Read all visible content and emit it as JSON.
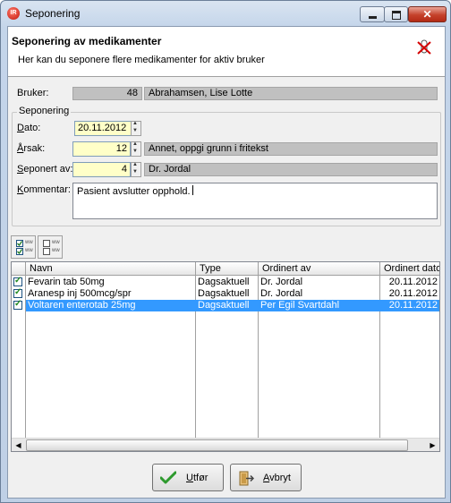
{
  "window": {
    "title": "Seponering"
  },
  "header": {
    "title": "Seponering av medikamenter",
    "subtitle": "Her kan du seponere flere medikamenter for aktiv bruker"
  },
  "bruker": {
    "label": "Bruker:",
    "id": "48",
    "name": "Abrahamsen, Lise Lotte"
  },
  "group": {
    "legend": "Seponering",
    "dato": {
      "label": "Dato:",
      "accel": "D",
      "rest": "ato:",
      "value": "20.11.2012"
    },
    "arsak": {
      "label": "Årsak:",
      "accel": "Å",
      "rest": "rsak:",
      "code": "12",
      "text": "Annet, oppgi grunn i fritekst"
    },
    "seponert_av": {
      "label": "Seponert av:",
      "accel": "S",
      "rest": "eponert av:",
      "code": "4",
      "text": "Dr. Jordal"
    },
    "kommentar": {
      "label": "Kommentar:",
      "accel": "K",
      "rest": "ommentar:",
      "value": "Pasient avslutter opphold."
    }
  },
  "toolbar": {
    "check_all": {
      "lines": [
        "ww",
        "ww"
      ]
    },
    "uncheck_all": {
      "lines": [
        "ww",
        "ww"
      ]
    }
  },
  "grid": {
    "columns": [
      "Navn",
      "Type",
      "Ordinert av",
      "Ordinert dato"
    ],
    "rows": [
      {
        "checked": true,
        "navn": "Fevarin tab 50mg",
        "type": "Dagsaktuell",
        "ordinert_av": "Dr. Jordal",
        "dato": "20.11.2012",
        "selected": false
      },
      {
        "checked": true,
        "navn": "Aranesp inj 500mcg/spr",
        "type": "Dagsaktuell",
        "ordinert_av": "Dr. Jordal",
        "dato": "20.11.2012",
        "selected": false
      },
      {
        "checked": true,
        "navn": "Voltaren enterotab 25mg",
        "type": "Dagsaktuell",
        "ordinert_av": "Per Egil Svartdahl",
        "dato": "20.11.2012",
        "selected": true
      }
    ]
  },
  "buttons": {
    "utfor": {
      "accel": "U",
      "rest": "tfør",
      "label": "Utfør"
    },
    "avbryt": {
      "accel": "A",
      "rest": "vbryt",
      "label": "Avbryt"
    }
  },
  "colors": {
    "selection": "#3399ff",
    "editable": "#ffffc8",
    "readonly": "#c0c0c0"
  }
}
